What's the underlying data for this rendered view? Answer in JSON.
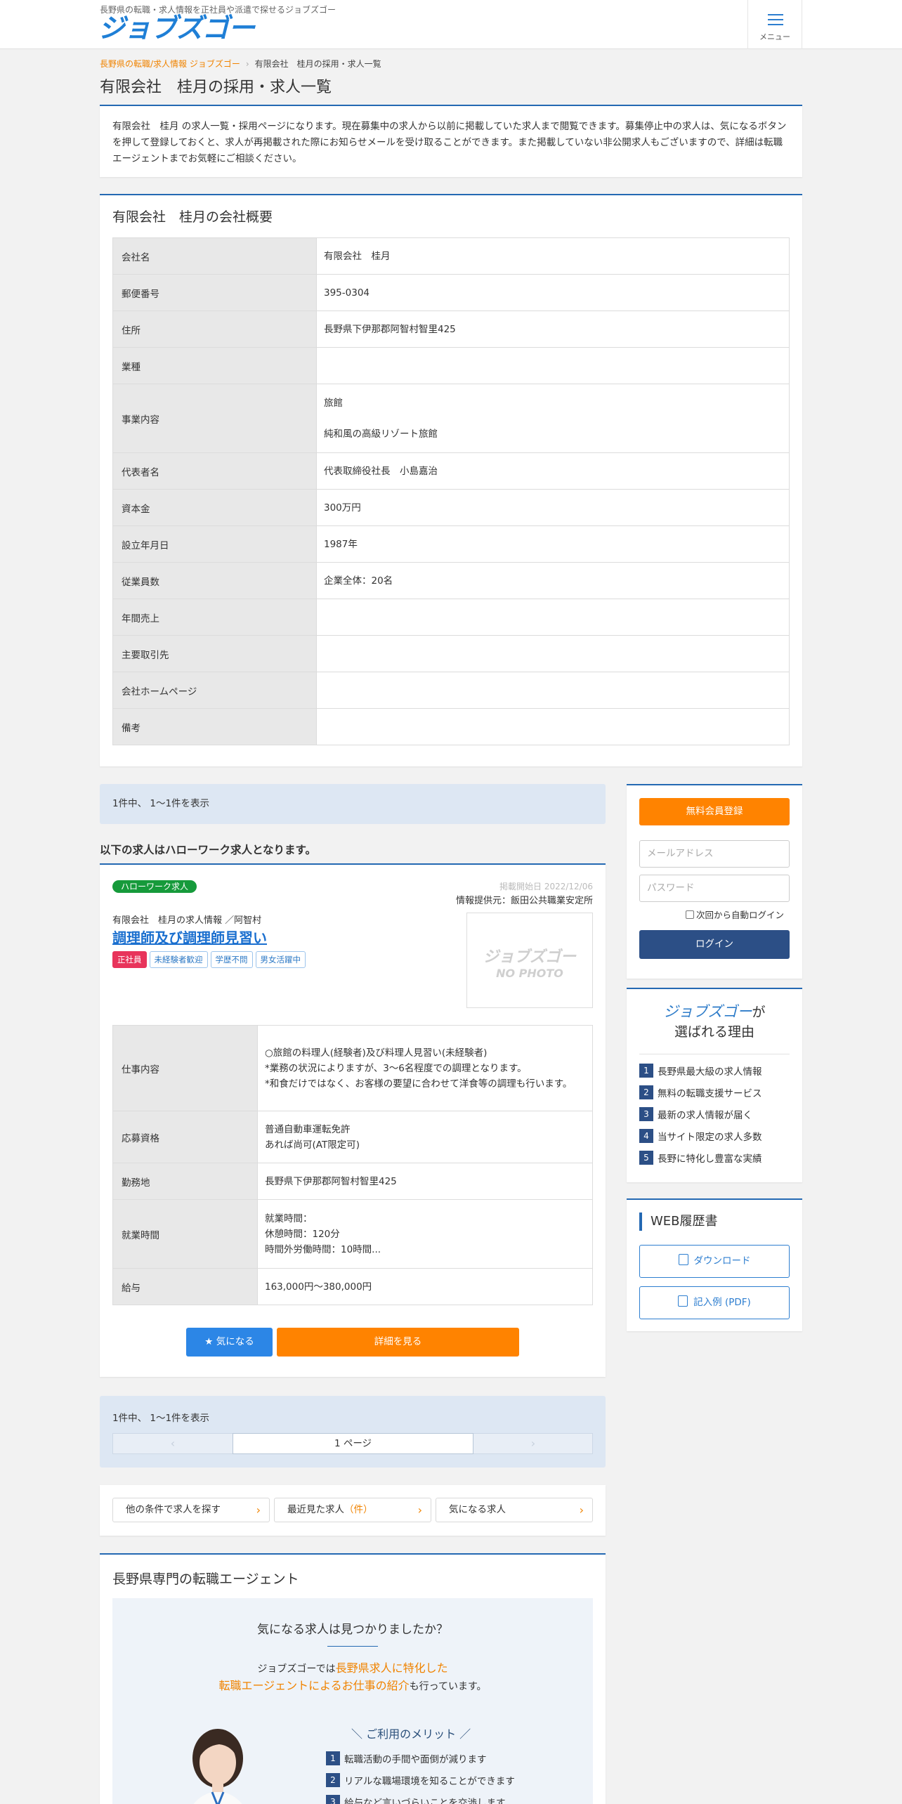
{
  "header": {
    "tagline": "長野県の転職・求人情報を正社員や派遣で探せるジョブズゴー",
    "logo": "ジョブズゴー",
    "menu_label": "メニュー"
  },
  "breadcrumb": {
    "home": "長野県の転職/求人情報 ジョブズゴー",
    "separator": "›",
    "current": "有限会社　桂月の採用・求人一覧"
  },
  "page_title": "有限会社　桂月の採用・求人一覧",
  "intro_text": "有限会社　桂月 の求人一覧・採用ページになります。現在募集中の求人から以前に掲載していた求人まで閲覧できます。募集停止中の求人は、気になるボタンを押して登録しておくと、求人が再掲載された際にお知らせメールを受け取ることができます。また掲載していない非公開求人もございますので、詳細は転職エージェントまでお気軽にご相談ください。",
  "overview": {
    "title": "有限会社　桂月の会社概要",
    "rows": [
      {
        "label": "会社名",
        "value": "有限会社　桂月"
      },
      {
        "label": "郵便番号",
        "value": "395-0304"
      },
      {
        "label": "住所",
        "value": "長野県下伊那郡阿智村智里425"
      },
      {
        "label": "業種",
        "value": ""
      },
      {
        "label": "事業内容",
        "value": "旅館\n\n純和風の高級リゾート旅館"
      },
      {
        "label": "代表者名",
        "value": "代表取締役社長　小島嘉治"
      },
      {
        "label": "資本金",
        "value": "300万円"
      },
      {
        "label": "設立年月日",
        "value": "1987年"
      },
      {
        "label": "従業員数",
        "value": "企業全体：20名"
      },
      {
        "label": "年間売上",
        "value": ""
      },
      {
        "label": "主要取引先",
        "value": ""
      },
      {
        "label": "会社ホームページ",
        "value": ""
      },
      {
        "label": "備考",
        "value": ""
      }
    ]
  },
  "results": {
    "count_text": "1件中、 1〜1件を表示",
    "hellowork_notice": "以下の求人はハローワーク求人となります。"
  },
  "job": {
    "badge": "ハローワーク求人",
    "published": "掲載開始日 2022/12/06",
    "provider": "情報提供元：飯田公共職業安定所",
    "company_line": "有限会社　桂月の求人情報 ／阿智村",
    "title": "調理師及び調理師見習い",
    "tags": [
      "正社員",
      "未経験者歓迎",
      "学歴不問",
      "男女活躍中"
    ],
    "nophoto_logo": "ジョブズゴー",
    "nophoto_text": "NO PHOTO",
    "rows": [
      {
        "label": "仕事内容",
        "value": "○旅館の料理人(経験者)及び料理人見習い(未経験者)\n*業務の状況によりますが、3～6名程度での調理となります。\n*和食だけではなく、お客様の要望に合わせて洋食等の調理も行います。"
      },
      {
        "label": "応募資格",
        "value": "普通自動車運転免許\nあれば尚可(AT限定可)"
      },
      {
        "label": "勤務地",
        "value": "長野県下伊那郡阿智村智里425"
      },
      {
        "label": "就業時間",
        "value": "就業時間：\n休憩時間：120分\n時間外労働時間：10時間..."
      },
      {
        "label": "給与",
        "value": "163,000円〜380,000円"
      }
    ],
    "fav_label": "気になる",
    "detail_label": "詳細を見る"
  },
  "pager": {
    "count_text": "1件中、 1〜1件を表示",
    "prev": "‹",
    "current": "1 ページ",
    "next": "›"
  },
  "links": [
    {
      "label": "他の条件で求人を探す",
      "count": ""
    },
    {
      "label": "最近見た求人",
      "count": "（件）"
    },
    {
      "label": "気になる求人",
      "count": ""
    }
  ],
  "agent": {
    "title": "長野県専門の転職エージェント",
    "question": "気になる求人は見つかりましたか？",
    "desc_pre": "ジョブズゴーでは",
    "desc_hl1": "長野県求人に特化した",
    "desc_hl2": "転職エージェントによるお仕事の紹介",
    "desc_post": "も行っています。",
    "merit_title": "＼ ご利用のメリット ／",
    "merits": [
      "転職活動の手間や面倒が減ります",
      "リアルな職場環境を知ることができます",
      "給与など言いづらいことを交渉します"
    ]
  },
  "sidebar": {
    "register_label": "無料会員登録",
    "email_placeholder": "メールアドレス",
    "password_placeholder": "パスワード",
    "auto_login_label": "次回から自動ログイン",
    "login_label": "ログイン",
    "reason_brand": "ジョブズゴー",
    "reason_suffix": "が",
    "reason_line2": "選ばれる理由",
    "reasons": [
      "長野県最大級の求人情報",
      "無料の転職支援サービス",
      "最新の求人情報が届く",
      "当サイト限定の求人多数",
      "長野に特化し豊富な実績"
    ],
    "resume_title": "WEB履歴書",
    "download_label": "ダウンロード",
    "sample_label": "記入例 (PDF)"
  },
  "colors": {
    "brand_blue": "#2469b3",
    "accent_orange": "#ff8300",
    "navy": "#2c4f86",
    "hellowork_green": "#169a3b",
    "tag_red": "#e8345b"
  }
}
